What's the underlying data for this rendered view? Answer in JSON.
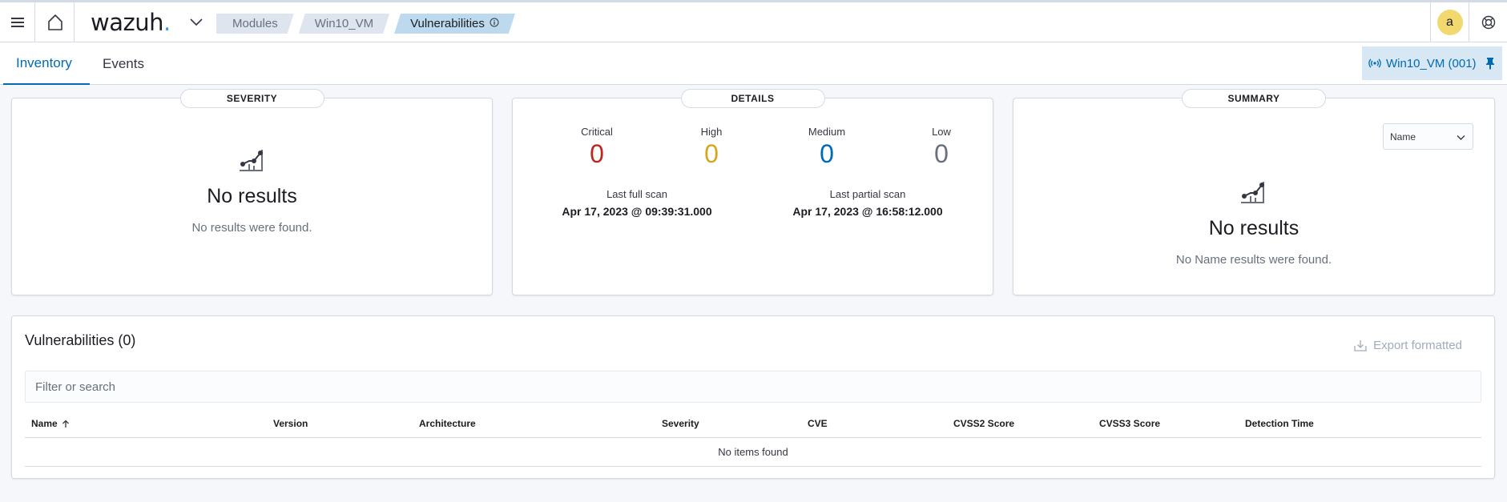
{
  "header": {
    "logo_text": "wazuh",
    "logo_dot": ".",
    "breadcrumbs": [
      "Modules",
      "Win10_VM",
      "Vulnerabilities"
    ],
    "user_initial": "a"
  },
  "tabs": {
    "inventory": "Inventory",
    "events": "Events",
    "agent_badge": "Win10_VM (001)"
  },
  "severity_card": {
    "title": "SEVERITY",
    "empty_title": "No results",
    "empty_body": "No results were found."
  },
  "details_card": {
    "title": "DETAILS",
    "severities": [
      {
        "label": "Critical",
        "value": "0",
        "color": "#bd271e"
      },
      {
        "label": "High",
        "value": "0",
        "color": "#d6a620"
      },
      {
        "label": "Medium",
        "value": "0",
        "color": "#006bb4"
      },
      {
        "label": "Low",
        "value": "0",
        "color": "#69707d"
      }
    ],
    "last_full_scan_label": "Last full scan",
    "last_full_scan_value": "Apr 17, 2023 @ 09:39:31.000",
    "last_partial_scan_label": "Last partial scan",
    "last_partial_scan_value": "Apr 17, 2023 @ 16:58:12.000"
  },
  "summary_card": {
    "title": "SUMMARY",
    "select_value": "Name",
    "empty_title": "No results",
    "empty_body": "No Name results were found."
  },
  "vulnerabilities": {
    "title": "Vulnerabilities (0)",
    "export_label": "Export formatted",
    "search_placeholder": "Filter or search",
    "columns": [
      "Name",
      "Version",
      "Architecture",
      "Severity",
      "CVE",
      "CVSS2 Score",
      "CVSS3 Score",
      "Detection Time"
    ],
    "empty_text": "No items found"
  },
  "icons": {
    "menu": "hamburger-icon",
    "home": "home-icon",
    "apps": "chevron-down-icon",
    "help": "help-lifebuoy-icon",
    "agent": "broadcast-icon",
    "pin": "pin-icon",
    "chart": "chart-line-icon",
    "export": "download-icon",
    "sort": "sort-up-icon"
  }
}
